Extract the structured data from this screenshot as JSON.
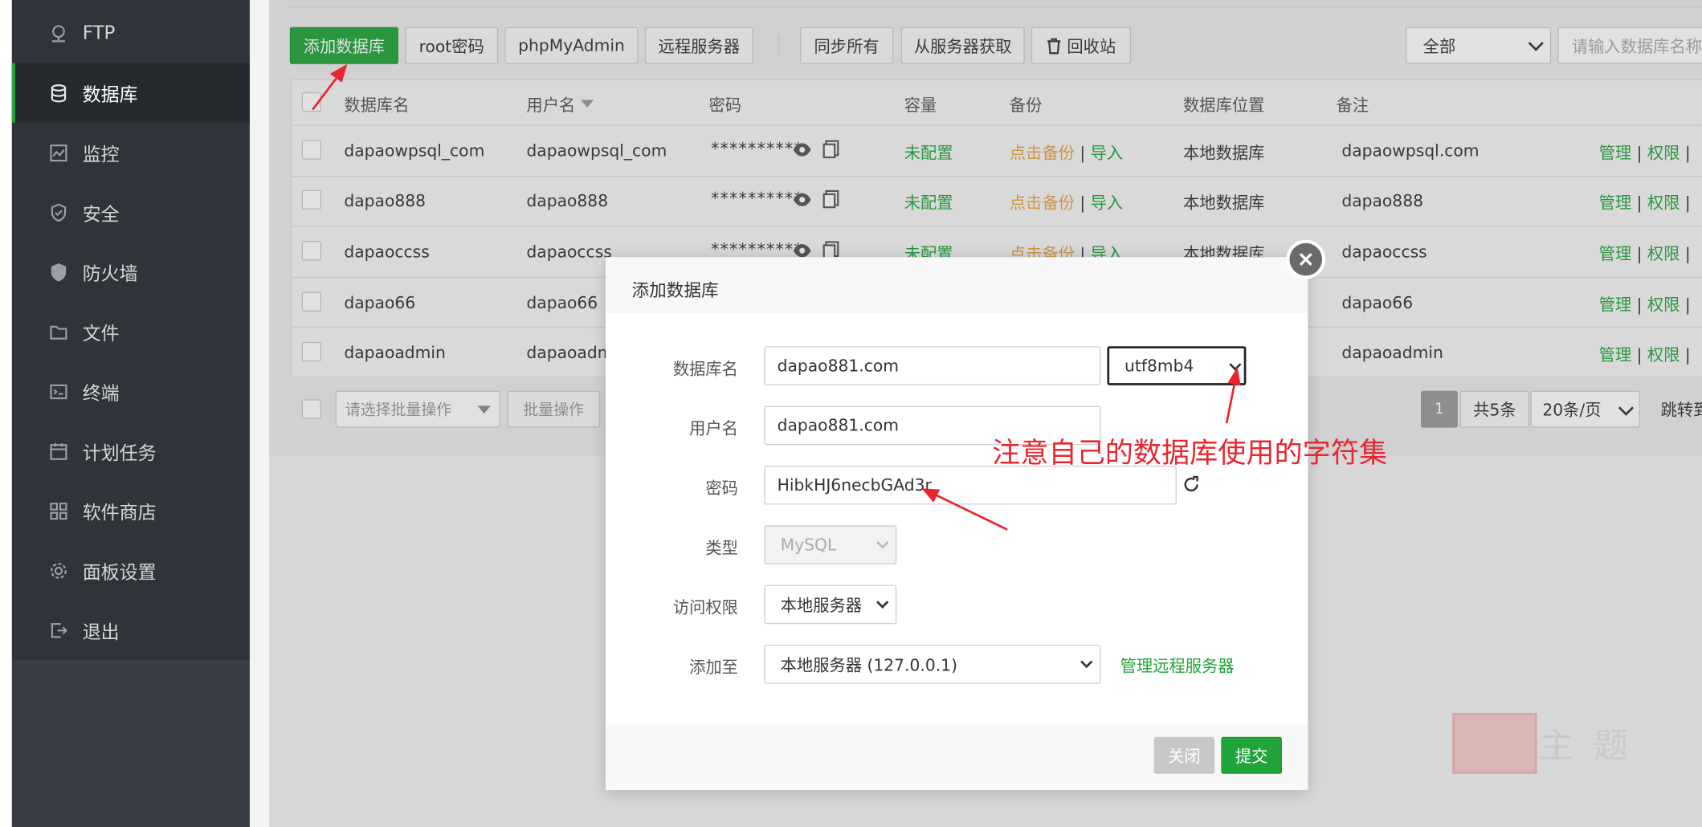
{
  "sidebar": {
    "items": [
      {
        "label": "FTP",
        "icon": "ftp-icon"
      },
      {
        "label": "数据库",
        "icon": "database-icon",
        "active": true
      },
      {
        "label": "监控",
        "icon": "monitor-icon"
      },
      {
        "label": "安全",
        "icon": "shield-icon"
      },
      {
        "label": "防火墙",
        "icon": "firewall-icon"
      },
      {
        "label": "文件",
        "icon": "folder-icon"
      },
      {
        "label": "终端",
        "icon": "terminal-icon"
      },
      {
        "label": "计划任务",
        "icon": "calendar-icon"
      },
      {
        "label": "软件商店",
        "icon": "apps-icon"
      },
      {
        "label": "面板设置",
        "icon": "gear-icon"
      },
      {
        "label": "退出",
        "icon": "logout-icon"
      }
    ]
  },
  "toolbar": {
    "add_db": "添加数据库",
    "root_pwd": "root密码",
    "phpmyadmin": "phpMyAdmin",
    "remote_server": "远程服务器",
    "sync_all": "同步所有",
    "fetch_server": "从服务器获取",
    "recycle": "回收站",
    "filter_value": "全部",
    "search_placeholder": "请输入数据库名称/"
  },
  "table": {
    "headers": {
      "name": "数据库名",
      "user": "用户名",
      "password": "密码",
      "capacity": "容量",
      "backup": "备份",
      "location": "数据库位置",
      "remark": "备注"
    },
    "rows": [
      {
        "name": "dapaowpsql_com",
        "user": "dapaowpsql_com",
        "password": "**********",
        "capacity": "未配置",
        "backup": "点击备份",
        "import": "导入",
        "location": "本地数据库",
        "remark": "dapaowpsql.com",
        "manage": "管理",
        "perm": "权限"
      },
      {
        "name": "dapao888",
        "user": "dapao888",
        "password": "**********",
        "capacity": "未配置",
        "backup": "点击备份",
        "import": "导入",
        "location": "本地数据库",
        "remark": "dapao888",
        "manage": "管理",
        "perm": "权限"
      },
      {
        "name": "dapaoccss",
        "user": "dapaoccss",
        "password": "**********",
        "capacity": "未配置",
        "backup": "点击备份",
        "import": "导入",
        "location": "本地数据库",
        "remark": "dapaoccss",
        "manage": "管理",
        "perm": "权限"
      },
      {
        "name": "dapao66",
        "user": "dapao66",
        "password": "",
        "capacity": "",
        "backup": "",
        "import": "",
        "location": "",
        "remark": "dapao66",
        "manage": "管理",
        "perm": "权限"
      },
      {
        "name": "dapaoadmin",
        "user": "dapaoadm",
        "password": "",
        "capacity": "",
        "backup": "",
        "import": "",
        "location": "",
        "remark": "dapaoadmin",
        "manage": "管理",
        "perm": "权限"
      }
    ],
    "batch_placeholder": "请选择批量操作",
    "batch_button": "批量操作",
    "pagination": {
      "current": "1",
      "total": "共5条",
      "per_page": "20条/页",
      "jump": "跳转到"
    }
  },
  "modal": {
    "title": "添加数据库",
    "fields": {
      "db_name_label": "数据库名",
      "db_name_value": "dapao881.com",
      "charset_value": "utf8mb4",
      "username_label": "用户名",
      "username_value": "dapao881.com",
      "password_label": "密码",
      "password_value": "HibkHJ6necbGAd3r",
      "type_label": "类型",
      "type_value": "MySQL",
      "access_label": "访问权限",
      "access_value": "本地服务器",
      "add_to_label": "添加至",
      "add_to_value": "本地服务器 (127.0.0.1)",
      "manage_remote": "管理远程服务器"
    },
    "close_button": "关闭",
    "submit_button": "提交"
  },
  "annotation": {
    "text": "注意自己的数据库使用的字符集",
    "color": "#e8262e"
  },
  "watermark": {
    "text": "主 题"
  },
  "colors": {
    "accent": "#20a53a",
    "sidebar": "#30343a",
    "backup": "#e5a146"
  }
}
